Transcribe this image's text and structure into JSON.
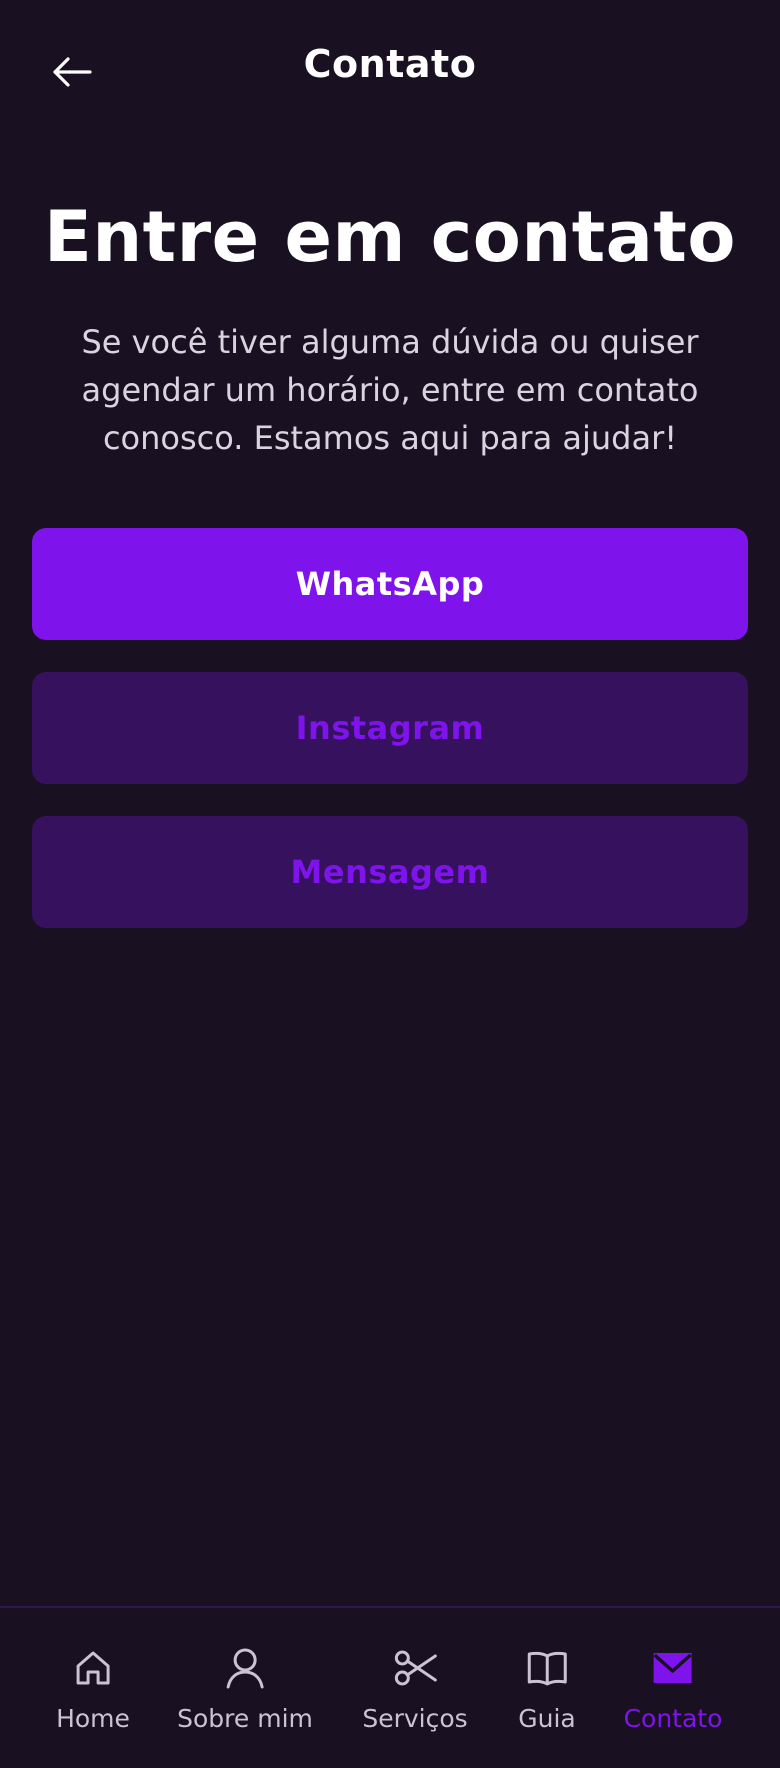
{
  "header": {
    "title": "Contato",
    "back_icon": "arrow-left-icon"
  },
  "main": {
    "title": "Entre em contato",
    "description": "Se você tiver alguma dúvida ou quiser agendar um horário, entre em contato conosco. Estamos aqui para ajudar!",
    "buttons": [
      {
        "label": "WhatsApp",
        "style": "primary"
      },
      {
        "label": "Instagram",
        "style": "secondary"
      },
      {
        "label": "Mensagem",
        "style": "secondary"
      }
    ]
  },
  "bottom_nav": {
    "items": [
      {
        "label": "Home",
        "icon": "home-icon",
        "active": false
      },
      {
        "label": "Sobre mim",
        "icon": "user-icon",
        "active": false
      },
      {
        "label": "Serviços",
        "icon": "scissors-icon",
        "active": false
      },
      {
        "label": "Guia",
        "icon": "book-icon",
        "active": false
      },
      {
        "label": "Contato",
        "icon": "mail-icon",
        "active": true
      }
    ]
  },
  "colors": {
    "background": "#191022",
    "accent": "#7f13ec",
    "secondary_button": "#36115d",
    "nav_inactive": "#c9c3d2"
  }
}
